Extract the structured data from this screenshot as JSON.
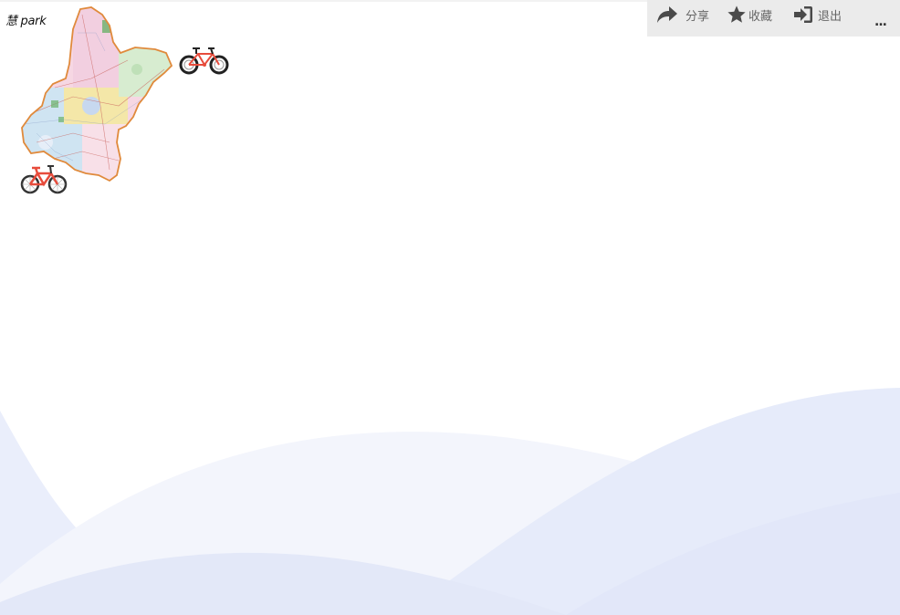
{
  "brand": {
    "text": "慧 park"
  },
  "toolbar": {
    "share_label": "分享",
    "favorite_label": "收藏",
    "logout_label": "退出",
    "more_label": "..."
  },
  "icons": {
    "share": "share-icon",
    "favorite": "star-icon",
    "logout": "sign-in-icon",
    "bike": "bicycle-icon",
    "map": "region-map"
  },
  "colors": {
    "toolbar_bg": "#ebebeb",
    "toolbar_text": "#666666",
    "wave_light": "#eef1fb",
    "wave_mid": "#e2e8f8",
    "bike_red": "#e74c3c"
  }
}
